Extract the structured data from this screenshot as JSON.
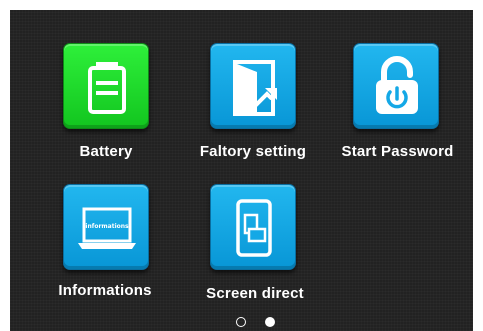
{
  "menu": {
    "items": [
      {
        "label": "Battery",
        "icon": "battery-icon",
        "color": "#1fd62c"
      },
      {
        "label": "Faltory setting",
        "icon": "door-exit-icon",
        "color": "#14a8e6"
      },
      {
        "label": "Start Password",
        "icon": "unlock-power-icon",
        "color": "#14a8e6"
      },
      {
        "label": "Informations",
        "icon": "laptop-icon",
        "color": "#14a8e6"
      },
      {
        "label": "Screen direct",
        "icon": "screen-rotate-icon",
        "color": "#14a8e6"
      }
    ],
    "laptop_screen_text": "informations"
  },
  "pager": {
    "total_pages": 2,
    "current_page": 2
  },
  "colors": {
    "background": "#222222",
    "tile_blue": "#14a8e6",
    "tile_green": "#1fd62c",
    "text": "#ffffff"
  }
}
